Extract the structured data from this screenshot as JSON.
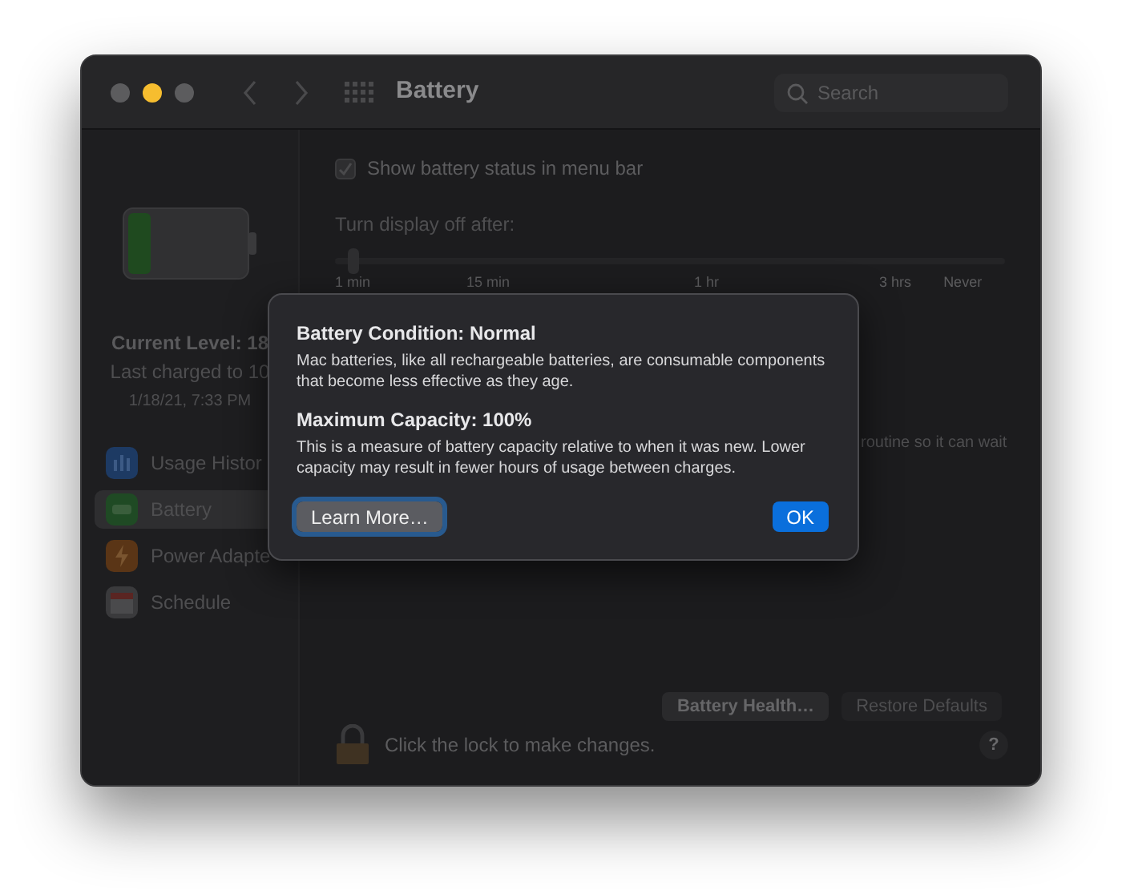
{
  "window": {
    "title": "Battery"
  },
  "search": {
    "placeholder": "Search"
  },
  "sidebar": {
    "status_lines": [
      "Current Level: 18",
      "Last charged to 10",
      "1/18/21, 7:33 PM"
    ],
    "items": [
      {
        "label": "Usage Histor",
        "kind": "usage",
        "selected": false
      },
      {
        "label": "Battery",
        "kind": "battery",
        "selected": true
      },
      {
        "label": "Power Adapte",
        "kind": "power",
        "selected": false
      },
      {
        "label": "Schedule",
        "kind": "schedule",
        "selected": false
      }
    ]
  },
  "main": {
    "show_status": {
      "label": "Show battery status in menu bar",
      "checked": true
    },
    "display_off": {
      "label": "Turn display off after:",
      "level": 0.02,
      "ticks": [
        "1 min",
        "15 min",
        "1 hr",
        "3 hrs",
        "Never"
      ]
    },
    "partial_text": "routine so it can wait",
    "buttons": [
      {
        "label": "Battery Health…",
        "disabled": false
      },
      {
        "label": "Restore Defaults",
        "disabled": true
      }
    ],
    "lock_text": "Click the lock to make changes.",
    "help": "?"
  },
  "dialog": {
    "sections": [
      {
        "title": "Battery Condition: Normal",
        "body": "Mac batteries, like all rechargeable batteries, are consumable components that become less effective as they age."
      },
      {
        "title": "Maximum Capacity: 100%",
        "body": "This is a measure of battery capacity relative to when it was new. Lower capacity may result in fewer hours of usage between charges."
      }
    ],
    "buttons": [
      {
        "label": "Learn More…",
        "kind": "secondary"
      },
      {
        "label": "OK",
        "kind": "primary"
      }
    ]
  }
}
